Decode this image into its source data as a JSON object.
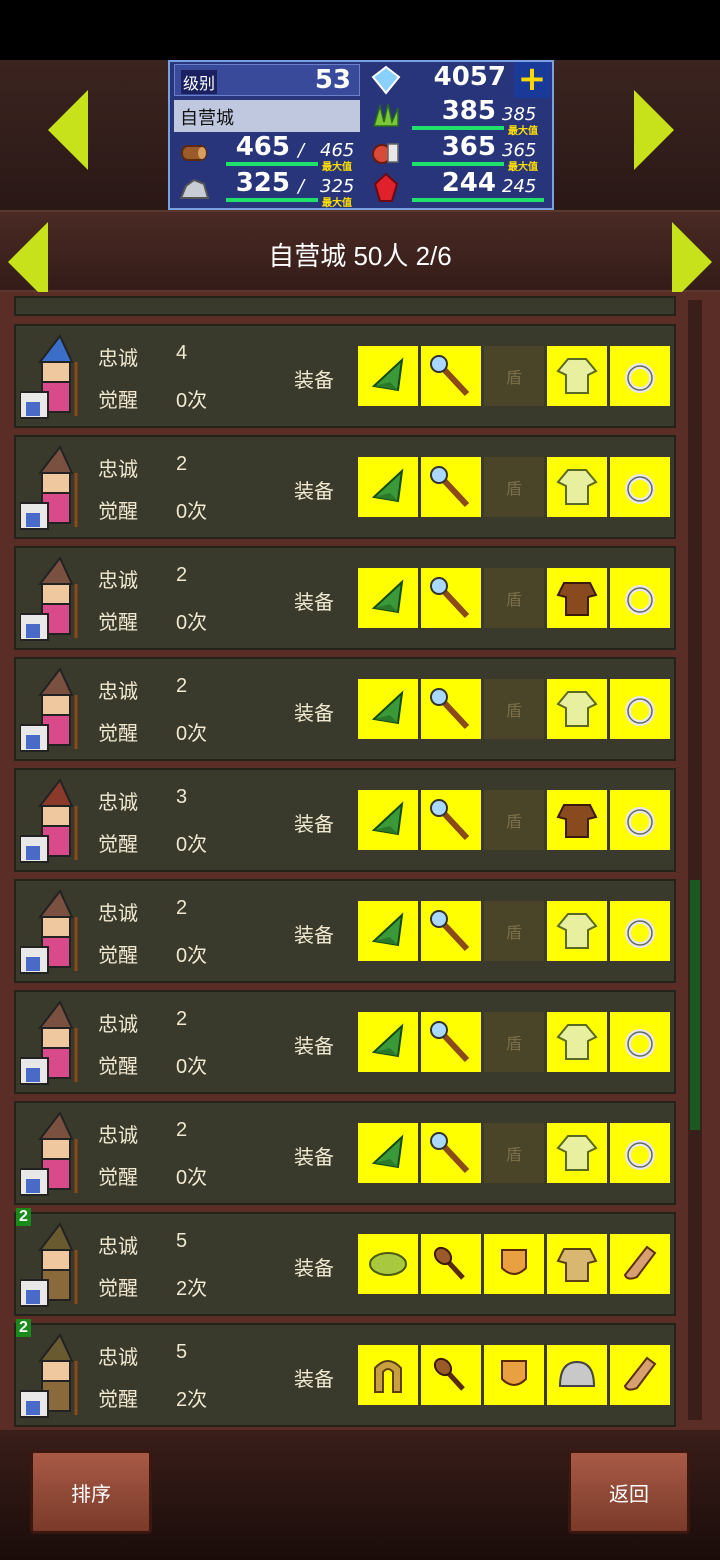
{
  "status": {
    "level_label": "级别",
    "level": "53",
    "gems": "4057",
    "plus_label": "+",
    "city_name": "自营城",
    "res": [
      {
        "name": "grass",
        "cur": "385",
        "max": "385",
        "max_label": "最大值"
      },
      {
        "name": "wood",
        "cur": "465",
        "max": "465",
        "max_label": "最大值"
      },
      {
        "name": "food",
        "cur": "365",
        "max": "365",
        "max_label": "最大值"
      },
      {
        "name": "ore",
        "cur": "325",
        "max": "325",
        "max_label": "最大值"
      },
      {
        "name": "ruby",
        "cur": "244",
        "max": "245"
      }
    ]
  },
  "title": "自营城  50人 2/6",
  "rows": [
    {
      "loyalty_label": "忠诚",
      "loyalty": "4",
      "awaken_label": "觉醒",
      "awaken": "0次",
      "equip_label": "装备",
      "shield": "盾",
      "hair": "#3a6ec8"
    },
    {
      "loyalty_label": "忠诚",
      "loyalty": "2",
      "awaken_label": "觉醒",
      "awaken": "0次",
      "equip_label": "装备",
      "shield": "盾",
      "hair": "#7a5040"
    },
    {
      "loyalty_label": "忠诚",
      "loyalty": "2",
      "awaken_label": "觉醒",
      "awaken": "0次",
      "equip_label": "装备",
      "shield": "盾",
      "hair": "#7a5040"
    },
    {
      "loyalty_label": "忠诚",
      "loyalty": "2",
      "awaken_label": "觉醒",
      "awaken": "0次",
      "equip_label": "装备",
      "shield": "盾",
      "hair": "#7a5040"
    },
    {
      "loyalty_label": "忠诚",
      "loyalty": "3",
      "awaken_label": "觉醒",
      "awaken": "0次",
      "equip_label": "装备",
      "shield": "盾",
      "hair": "#8a3a2a"
    },
    {
      "loyalty_label": "忠诚",
      "loyalty": "2",
      "awaken_label": "觉醒",
      "awaken": "0次",
      "equip_label": "装备",
      "shield": "盾",
      "hair": "#7a5040"
    },
    {
      "loyalty_label": "忠诚",
      "loyalty": "2",
      "awaken_label": "觉醒",
      "awaken": "0次",
      "equip_label": "装备",
      "shield": "盾",
      "hair": "#7a5040"
    },
    {
      "loyalty_label": "忠诚",
      "loyalty": "2",
      "awaken_label": "觉醒",
      "awaken": "0次",
      "equip_label": "装备",
      "shield": "盾",
      "hair": "#7a5040"
    },
    {
      "loyalty_label": "忠诚",
      "loyalty": "5",
      "awaken_label": "觉醒",
      "awaken": "2次",
      "equip_label": "装备",
      "badge": "2",
      "hair": "#6a5a30"
    },
    {
      "loyalty_label": "忠诚",
      "loyalty": "5",
      "awaken_label": "觉醒",
      "awaken": "2次",
      "equip_label": "装备",
      "badge": "2",
      "hair": "#6a5a30"
    }
  ],
  "footer": {
    "sort_label": "排序",
    "back_label": "返回"
  },
  "colors": {
    "accent": "#c7e21a",
    "slot": "#ffff00",
    "panel": "#3a3a2c",
    "bar": "#1fe06a"
  }
}
